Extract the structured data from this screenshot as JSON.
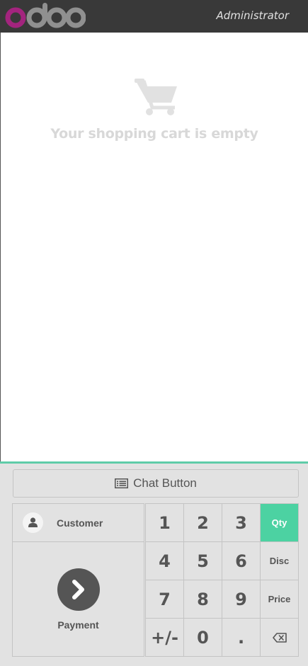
{
  "header": {
    "logo_text": "odoo",
    "user_name": "Administrator"
  },
  "order": {
    "empty_icon": "shopping-cart-icon",
    "empty_message": "Your shopping cart is empty"
  },
  "control": {
    "chat_button": {
      "icon": "list-alt-icon",
      "label": "Chat Button"
    },
    "customer": {
      "icon": "user-icon",
      "label": "Customer"
    },
    "payment": {
      "icon": "chevron-right-icon",
      "label": "Payment"
    },
    "numpad": {
      "keys": [
        "1",
        "2",
        "3",
        "4",
        "5",
        "6",
        "7",
        "8",
        "9",
        "+/-",
        "0",
        "."
      ],
      "modes": [
        "Qty",
        "Disc",
        "Price"
      ],
      "active_mode": "Qty",
      "backspace_icon": "backspace-icon"
    }
  },
  "colors": {
    "header_bg": "#393939",
    "logo_o": "#a3247e",
    "accent": "#4cd2a2",
    "divider": "#5fcca8"
  }
}
